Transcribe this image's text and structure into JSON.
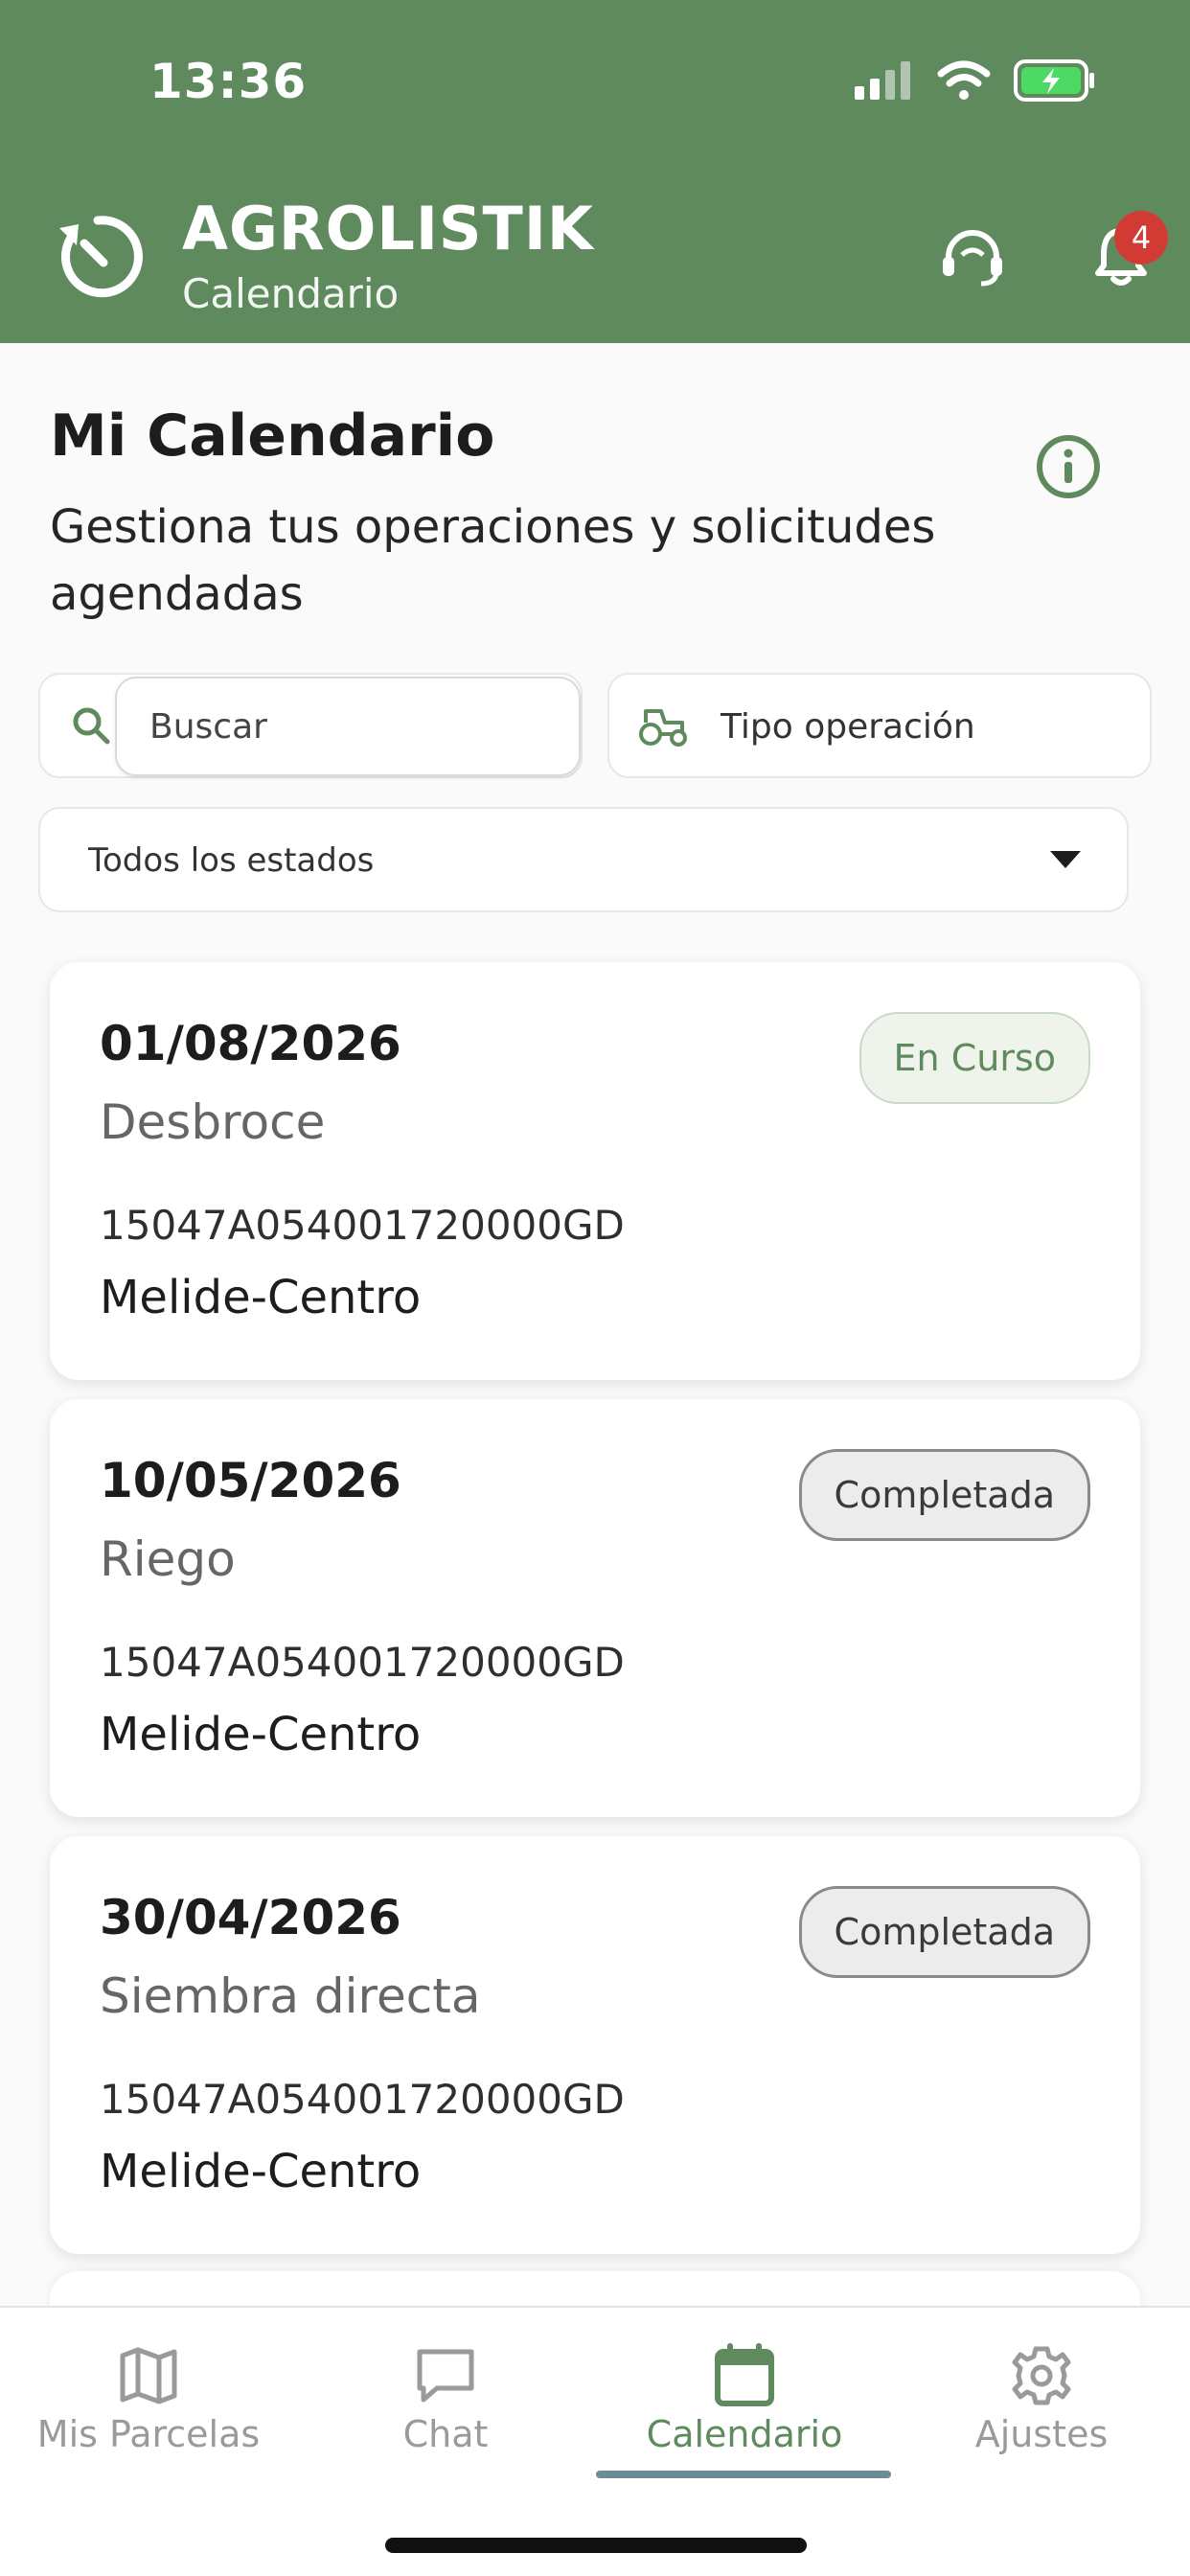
{
  "status_bar": {
    "time": "13:36"
  },
  "header": {
    "app_name": "AGROLISTIK",
    "section": "Calendario",
    "notification_count": "4"
  },
  "page": {
    "title": "Mi Calendario",
    "subtitle": "Gestiona tus operaciones y solicitudes agendadas"
  },
  "filters": {
    "search_placeholder": "Buscar",
    "operation_type_label": "Tipo operación",
    "status_label": "Todos los estados"
  },
  "operations": [
    {
      "date": "01/08/2026",
      "operation": "Desbroce",
      "reference": "15047A054001720000GD",
      "place": "Melide-Centro",
      "status": "En Curso"
    },
    {
      "date": "10/05/2026",
      "operation": "Riego",
      "reference": "15047A054001720000GD",
      "place": "Melide-Centro",
      "status": "Completada"
    },
    {
      "date": "30/04/2026",
      "operation": "Siembra directa",
      "reference": "15047A054001720000GD",
      "place": "Melide-Centro",
      "status": "Completada"
    }
  ],
  "bottom_nav": [
    {
      "label": "Mis Parcelas",
      "icon": "map-icon"
    },
    {
      "label": "Chat",
      "icon": "chat-icon"
    },
    {
      "label": "Calendario",
      "icon": "calendar-icon",
      "active": true
    },
    {
      "label": "Ajustes",
      "icon": "gear-icon"
    }
  ],
  "colors": {
    "primary_green": "#5f8a5e",
    "badge_red": "#d23b33",
    "nav_indicator": "#6b8b9a"
  }
}
